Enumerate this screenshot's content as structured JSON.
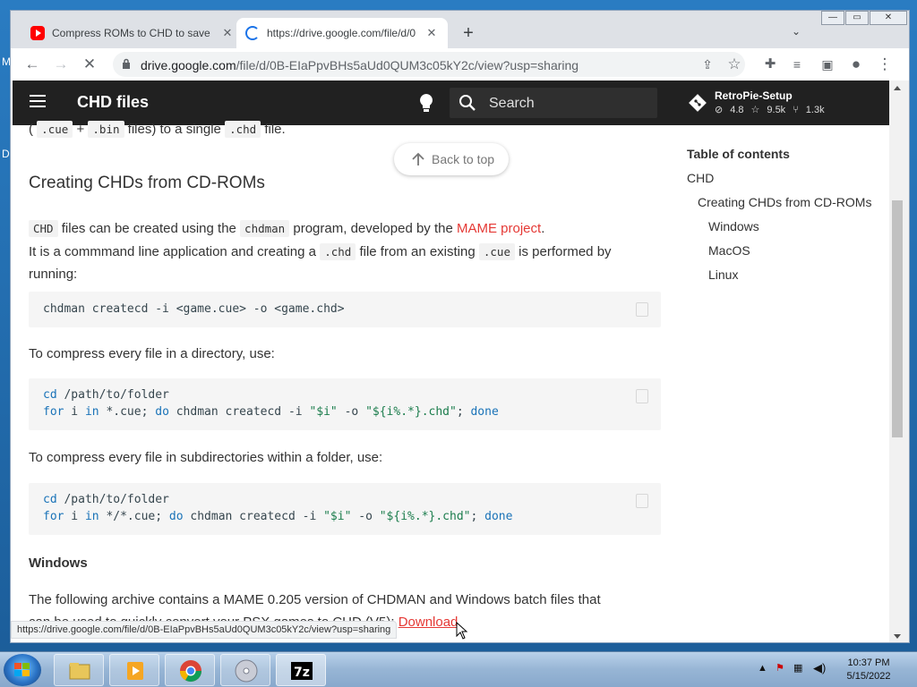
{
  "browser": {
    "tabs": [
      {
        "title": "Compress ROMs to CHD to save",
        "active": false
      },
      {
        "title": "https://drive.google.com/file/d/0",
        "active": true
      }
    ],
    "url_host": "drive.google.com",
    "url_path": "/file/d/0B-EIaPpvBHs5aUd0QUM3c05kY2c/view?usp=sharing",
    "status_url": "https://drive.google.com/file/d/0B-EIaPpvBHs5aUd0QUM3c05kY2c/view?usp=sharing"
  },
  "header": {
    "title": "CHD files",
    "search_placeholder": "Search",
    "repo_name": "RetroPie-Setup",
    "repo_version": "4.8",
    "repo_stars": "9.5k",
    "repo_forks": "1.3k"
  },
  "back_to_top": "Back to top",
  "content": {
    "prev_text_a": "(",
    "prev_code_1": ".cue",
    "prev_plus": "+",
    "prev_code_2": ".bin",
    "prev_text_b": "files) to a single",
    "prev_code_3": ".chd",
    "prev_text_c": "file.",
    "heading": "Creating CHDs from CD-ROMs",
    "p1_code": "CHD",
    "p1_text": "files can be created using the",
    "p1_code2": "chdman",
    "p1_text2": "program, developed by the",
    "p1_link": "MAME project",
    "p1_end": ".",
    "p2_text": "It is a commmand line application and creating a",
    "p2_code": ".chd",
    "p2_text2": "file from an existing",
    "p2_code2": ".cue",
    "p2_text3": "is performed by",
    "p3_text": "running:",
    "code1": "chdman createcd -i <game.cue> -o <game.chd>",
    "para_dir": "To compress every file in a directory, use:",
    "code2_l1_kw": "cd",
    "code2_l1_rest": " /path/to/folder",
    "code2_l2_for": "for",
    "code2_l2_i": " i ",
    "code2_l2_in": "in",
    "code2_l2_glob": " *.cue; ",
    "code2_l2_do": "do",
    "code2_l2_cmd": " chdman createcd -i ",
    "code2_l2_s1": "\"$i\"",
    "code2_l2_o": " -o ",
    "code2_l2_s2": "\"${i%.*}.chd\"",
    "code2_l2_semi": "; ",
    "code2_l2_done": "done",
    "para_sub": "To compress every file in subdirectories within a folder, use:",
    "code3_l1_kw": "cd",
    "code3_l1_rest": " /path/to/folder",
    "code3_l2_for": "for",
    "code3_l2_i": " i ",
    "code3_l2_in": "in",
    "code3_l2_glob": " */*.cue; ",
    "code3_l2_do": "do",
    "code3_l2_cmd": " chdman createcd -i ",
    "code3_l2_s1": "\"$i\"",
    "code3_l2_o": " -o ",
    "code3_l2_s2": "\"${i%.*}.chd\"",
    "code3_l2_semi": "; ",
    "code3_l2_done": "done",
    "windows_heading": "Windows",
    "win_para": "The following archive contains a MAME 0.205 version of CHDMAN and Windows batch files that",
    "win_para2": "can be used to quickly convert your PSX games to CHD (V5):",
    "download_link": "Download"
  },
  "toc": {
    "title": "Table of contents",
    "items": [
      {
        "label": "CHD",
        "level": 0
      },
      {
        "label": "Creating CHDs from CD-ROMs",
        "level": 1
      },
      {
        "label": "Windows",
        "level": 2
      },
      {
        "label": "MacOS",
        "level": 2
      },
      {
        "label": "Linux",
        "level": 2
      }
    ]
  },
  "taskbar": {
    "time": "10:37 PM",
    "date": "5/15/2022"
  },
  "colors": {
    "header_bg": "#212121",
    "link_red": "#e53935",
    "chrome_frame": "#dee1e6"
  }
}
